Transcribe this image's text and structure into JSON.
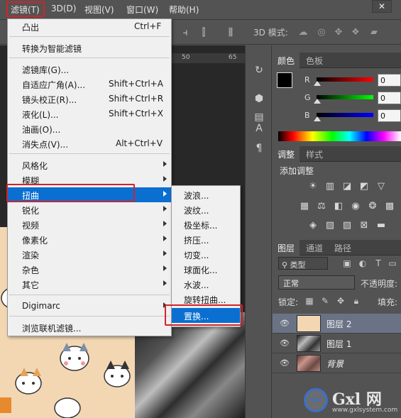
{
  "menubar": {
    "items": [
      "滤镜(T)",
      "3D(D)",
      "视图(V)",
      "窗口(W)",
      "帮助(H)"
    ],
    "close_label": "✕"
  },
  "optionsbar": {
    "mode3d_label": "3D 模式:"
  },
  "ruler": {
    "ticks": [
      "50",
      "65"
    ]
  },
  "filter_menu": {
    "items": [
      {
        "label": "凸出",
        "shortcut": "Ctrl+F"
      },
      {
        "label": "转换为智能滤镜",
        "shortcut": ""
      },
      {
        "label": "滤镜库(G)...",
        "shortcut": ""
      },
      {
        "label": "自适应广角(A)...",
        "shortcut": "Shift+Ctrl+A"
      },
      {
        "label": "镜头校正(R)...",
        "shortcut": "Shift+Ctrl+R"
      },
      {
        "label": "液化(L)...",
        "shortcut": "Shift+Ctrl+X"
      },
      {
        "label": "油画(O)...",
        "shortcut": ""
      },
      {
        "label": "消失点(V)...",
        "shortcut": "Alt+Ctrl+V"
      },
      {
        "label": "风格化",
        "shortcut": ""
      },
      {
        "label": "模糊",
        "shortcut": ""
      },
      {
        "label": "扭曲",
        "shortcut": ""
      },
      {
        "label": "锐化",
        "shortcut": ""
      },
      {
        "label": "视频",
        "shortcut": ""
      },
      {
        "label": "像素化",
        "shortcut": ""
      },
      {
        "label": "渲染",
        "shortcut": ""
      },
      {
        "label": "杂色",
        "shortcut": ""
      },
      {
        "label": "其它",
        "shortcut": ""
      },
      {
        "label": "Digimarc",
        "shortcut": ""
      },
      {
        "label": "浏览联机滤镜...",
        "shortcut": ""
      }
    ],
    "highlighted": "扭曲"
  },
  "distort_submenu": {
    "items": [
      "波浪...",
      "波纹...",
      "极坐标...",
      "挤压...",
      "切变...",
      "球面化...",
      "水波...",
      "旋转扭曲...",
      "置换..."
    ],
    "highlighted": "置换..."
  },
  "color_panel": {
    "tabs": [
      "颜色",
      "色板"
    ],
    "rows": [
      {
        "label": "R",
        "value": "0"
      },
      {
        "label": "G",
        "value": "0"
      },
      {
        "label": "B",
        "value": "0"
      }
    ]
  },
  "adjust_panel": {
    "tabs": [
      "调整",
      "样式"
    ],
    "title": "添加调整"
  },
  "layers_panel": {
    "tabs": [
      "图层",
      "通道",
      "路径"
    ],
    "filter_type": "类型",
    "blend_mode": "正常",
    "opacity_label": "不透明度:",
    "lock_label": "锁定:",
    "fill_label": "填充:",
    "layers": [
      {
        "name": "图层 2",
        "selected": true
      },
      {
        "name": "图层 1",
        "selected": false
      },
      {
        "name": "背景",
        "selected": false
      }
    ]
  },
  "watermark": {
    "logo_text": "Gxl",
    "name": "Gxl 网",
    "url": "www.gxlsystem.com"
  },
  "colors": {
    "menu_highlight": "#0a6fd1",
    "annotation_red": "#d2232a",
    "panel_bg": "#535353"
  }
}
